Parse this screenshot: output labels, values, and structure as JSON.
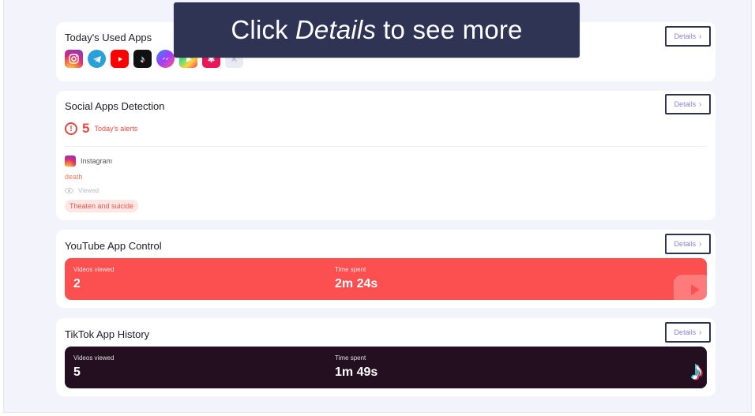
{
  "callout": {
    "prefix": "Click",
    "emphasis": "Details",
    "suffix": "to see more"
  },
  "used_apps": {
    "title": "Today's Used Apps",
    "details_label": "Details",
    "icons": [
      "instagram-icon",
      "telegram-icon",
      "youtube-icon",
      "tiktok-icon",
      "messenger-icon",
      "play-store-icon",
      "yelp-icon",
      "other-apps-icon"
    ]
  },
  "social_detection": {
    "title": "Social Apps Detection",
    "details_label": "Details",
    "alert_count": "5",
    "alert_text": "Today's alerts",
    "item": {
      "app": "Instagram",
      "keyword": "death",
      "status": "Viewed",
      "tag": "Theaten and suicide"
    }
  },
  "youtube_control": {
    "title": "YouTube App Control",
    "details_label": "Details",
    "videos_label": "Videos viewed",
    "videos_value": "2",
    "time_label": "Time spent",
    "time_value": "2m 24s"
  },
  "tiktok_history": {
    "title": "TikTok App History",
    "details_label": "Details",
    "videos_label": "Videos viewed",
    "videos_value": "5",
    "time_label": "Time spent",
    "time_value": "1m 49s"
  },
  "colors": {
    "callout_bg": "#2f3354",
    "accent_red": "#fc4f4f",
    "tiktok_dark": "#230f1f",
    "details_text": "#8a82d8"
  }
}
